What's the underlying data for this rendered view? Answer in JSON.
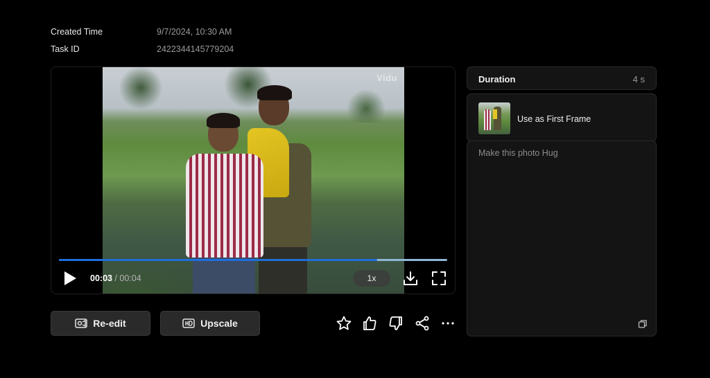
{
  "meta": {
    "created_label": "Created Time",
    "created_value": "9/7/2024, 10:30 AM",
    "task_label": "Task ID",
    "task_value": "2422344145779204"
  },
  "player": {
    "watermark": "Vidu",
    "current_time": "00:03",
    "separator": " / ",
    "total_time": "00:04",
    "progress": 0.82,
    "speed": "1x",
    "icons": [
      "play-icon",
      "download-icon",
      "fullscreen-icon"
    ]
  },
  "actions": {
    "reedit_label": "Re-edit",
    "upscale_label": "Upscale",
    "icons": [
      "star-icon",
      "thumbs-up-icon",
      "thumbs-down-icon",
      "share-icon",
      "more-icon"
    ]
  },
  "sidebar": {
    "duration_label": "Duration",
    "duration_value": "4 s",
    "first_frame_label": "Use as First Frame",
    "prompt": "Make this photo Hug"
  },
  "colors": {
    "background": "#000000",
    "panel": "#141414",
    "progress_fill": "#1e6fd9",
    "progress_track": "#8fb8d6"
  }
}
